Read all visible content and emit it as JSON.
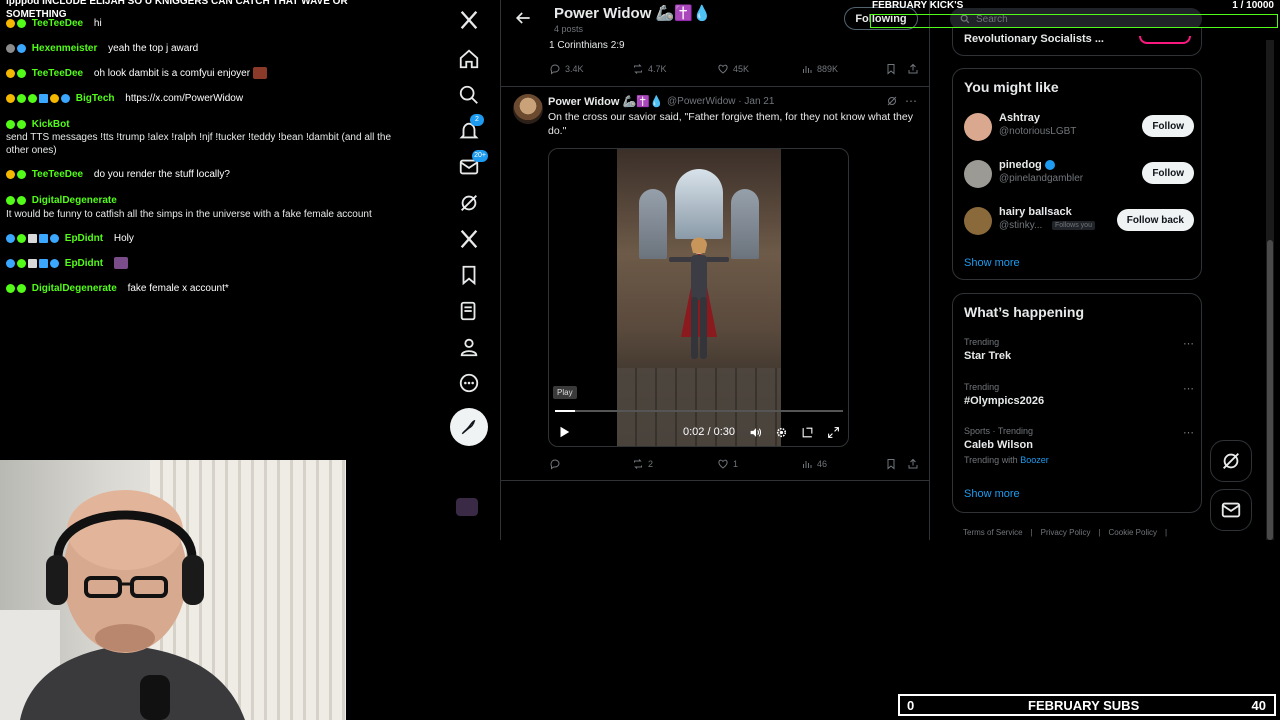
{
  "chat": {
    "top_cut": "ipppod INCLUDE ELIJAH SO U KNIGGERS CAN CATCH THAT WAVE OR SOMETHING",
    "messages": [
      {
        "user": "TeeTeeDee",
        "text": "hi"
      },
      {
        "user": "Hexenmeister",
        "text": "yeah the top j award"
      },
      {
        "user": "TeeTeeDee",
        "text": "oh look dambit is a comfyui enjoyer"
      },
      {
        "user": "BigTech",
        "text": "https://x.com/PowerWidow"
      },
      {
        "user": "KickBot",
        "text": "send TTS messages !tts !trump !alex !ralph !njf !tucker !teddy !bean !dambit (and all the other ones)"
      },
      {
        "user": "TeeTeeDee",
        "text": "do you render the stuff locally?"
      },
      {
        "user": "DigitalDegenerate",
        "text": "It would be funny to catfish all the simps in the universe with a fake female account"
      },
      {
        "user": "EpDidnt",
        "text": "Holy"
      },
      {
        "user": "EpDidnt",
        "text": ""
      },
      {
        "user": "DigitalDegenerate",
        "text": "fake female x account*"
      }
    ]
  },
  "xnav": {
    "items": [
      "x-logo",
      "home",
      "explore",
      "notifications",
      "messages",
      "grok",
      "premium",
      "bookmarks",
      "articles",
      "profile",
      "more"
    ],
    "notif_badge": "2",
    "messages_badge": "20+"
  },
  "header": {
    "profile_name": "Power Widow 🦾✝️💧",
    "post_count": "4 posts",
    "following_label": "Following",
    "search_placeholder": "Search"
  },
  "prev_tweet": {
    "text": "1 Corinthians 2:9",
    "replies": "3.4K",
    "reposts": "4.7K",
    "likes": "45K",
    "views": "889K"
  },
  "tweet": {
    "name": "Power Widow 🦾✝️💧",
    "handle": "@PowerWidow · Jan 21",
    "text": "On the cross our savior said, \"Father forgive them, for they not know what they do.\"",
    "video": {
      "tooltip": "Play",
      "time": "0:02 / 0:30",
      "progress": 0.07
    },
    "replies": "",
    "reposts": "2",
    "likes": "1",
    "views": "46"
  },
  "right": {
    "cut_item": "Revolutionary Socialists ...",
    "you_might_like": {
      "title": "You might like",
      "users": [
        {
          "name": "Ashtray",
          "handle": "@notoriousLGBT",
          "button": "Follow",
          "follows_you": "",
          "avatar_color": "#d9a88e"
        },
        {
          "name": "pinedog",
          "handle": "@pinelandgambler",
          "button": "Follow",
          "follows_you": "",
          "avatar_color": "#9c9a94"
        },
        {
          "name": "hairy ballsack",
          "handle": "@stinky...",
          "button": "Follow back",
          "follows_you": "Follows you",
          "avatar_color": "#8a6a3a"
        }
      ],
      "show_more": "Show more"
    },
    "whats_happening": {
      "title": "What’s happening",
      "trends": [
        {
          "meta": "Trending",
          "name": "Star Trek",
          "sub_label": "",
          "sub_link": ""
        },
        {
          "meta": "Trending",
          "name": "#Olympics2026",
          "sub_label": "",
          "sub_link": ""
        },
        {
          "meta": "Sports · Trending",
          "name": "Caleb Wilson",
          "sub_label": "Trending with",
          "sub_link": "Boozer"
        }
      ],
      "show_more": "Show more"
    },
    "footer": [
      "Terms of Service",
      "Privacy Policy",
      "Cookie Policy"
    ]
  },
  "overlay": {
    "goal_label": "FEBRUARY KICK'S",
    "goal_count": "1 / 10000",
    "subs_left": "0",
    "subs_label": "FEBRUARY SUBS",
    "subs_right": "40"
  },
  "colors": {
    "kick_green": "#53fc18",
    "x_blue": "#1d9bf0",
    "border": "#2f3336"
  }
}
